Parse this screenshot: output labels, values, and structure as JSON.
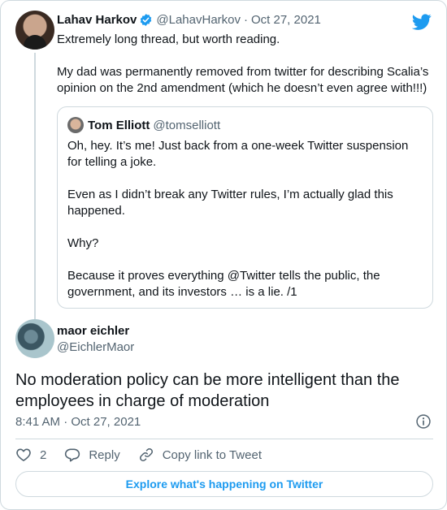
{
  "parent_tweet": {
    "name": "Lahav Harkov",
    "handle": "@LahavHarkov",
    "separator": "·",
    "date": "Oct 27, 2021",
    "line1": "Extremely long thread, but worth reading.",
    "line2": "My dad was permanently removed from twitter for describing Scalia’s opinion on the 2nd amendment (which he doesn’t even agree with!!!)"
  },
  "quoted_tweet": {
    "name": "Tom Elliott",
    "handle": "@tomselliott",
    "para1": "Oh, hey. It’s me! Just back from a one-week Twitter suspension for telling a joke.",
    "para2": "Even as I didn’t break any Twitter rules, I’m actually glad this happened.",
    "para3": "Why?",
    "para4": "Because it proves everything @Twitter tells the public, the government, and its investors … is a lie. /1"
  },
  "main_tweet": {
    "name": "maor eichler",
    "handle": "@EichlerMaor",
    "text": "No moderation policy can be more intelligent than the employees in charge of moderation",
    "timestamp": "8:41 AM · Oct 27, 2021"
  },
  "actions": {
    "like_count": "2",
    "reply_label": "Reply",
    "copy_link_label": "Copy link to Tweet"
  },
  "explore_label": "Explore what's happening on Twitter",
  "icons": {
    "verified": "verified-badge-icon",
    "brand": "twitter-bird-icon",
    "info": "info-icon",
    "like": "heart-icon",
    "reply": "reply-bubble-icon",
    "link": "link-icon"
  },
  "colors": {
    "accent": "#1d9bf0",
    "text": "#0f1419",
    "secondary": "#536471",
    "border": "#cfd9de"
  }
}
